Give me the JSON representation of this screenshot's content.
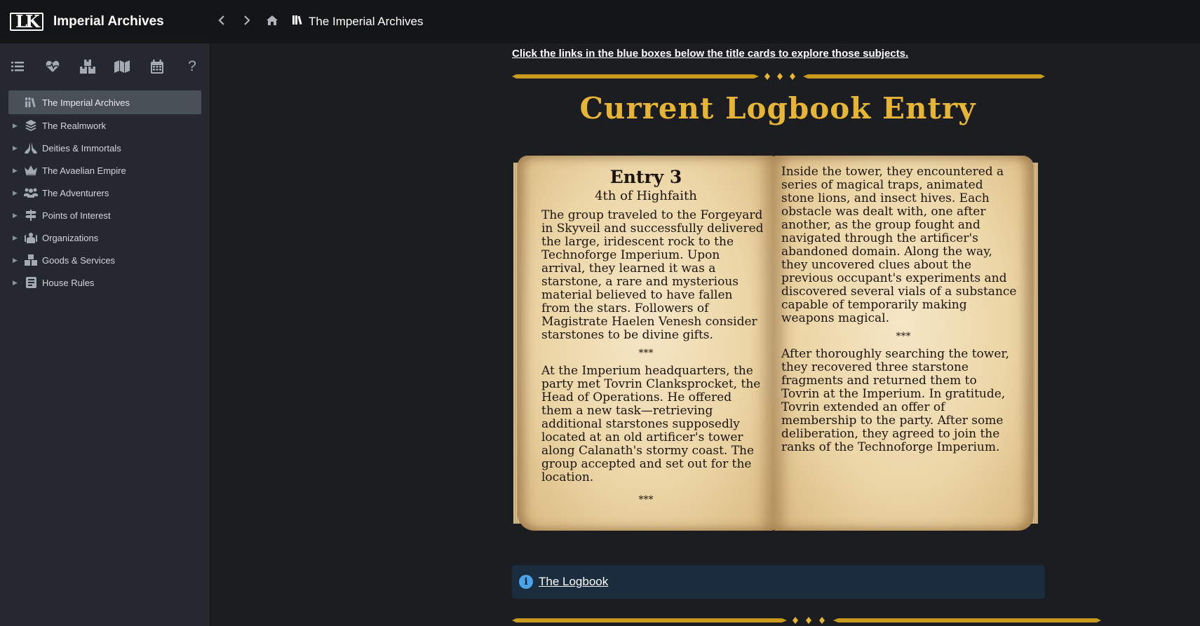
{
  "header": {
    "logo_text": "LK",
    "app_title": "Imperial Archives",
    "breadcrumb": "The Imperial Archives"
  },
  "toolbar": {
    "tools": [
      "list-icon",
      "heart-pulse-icon",
      "boxes-icon",
      "map-icon",
      "calendar-icon",
      "help-icon"
    ],
    "help_label": "?"
  },
  "sidebar": {
    "items": [
      {
        "label": "The Imperial Archives",
        "icon": "library-icon",
        "active": true
      },
      {
        "label": "The Realmwork",
        "icon": "layers-icon"
      },
      {
        "label": "Deities & Immortals",
        "icon": "praying-hands-icon"
      },
      {
        "label": "The Avaelian Empire",
        "icon": "crown-icon"
      },
      {
        "label": "The Adventurers",
        "icon": "users-icon"
      },
      {
        "label": "Points of Interest",
        "icon": "signpost-icon"
      },
      {
        "label": "Organizations",
        "icon": "group-icon"
      },
      {
        "label": "Goods & Services",
        "icon": "boxes-icon"
      },
      {
        "label": "House Rules",
        "icon": "rulebook-icon"
      }
    ]
  },
  "main": {
    "hint": "Click the links in the blue boxes below the title cards to explore those subjects.",
    "section_title": "Current Logbook Entry",
    "book": {
      "entry_title": "Entry 3",
      "entry_date": "4th of Highfaith",
      "left_p1": "The group traveled to the Forgeyard in Skyveil and successfully delivered the large, iridescent rock to the Technoforge Imperium. Upon arrival, they learned it was a starstone, a rare and mysterious material believed to have fallen from the stars. Followers of Magistrate Haelen Venesh consider starstones to be divine gifts.",
      "left_p2": "At the Imperium headquarters, the party met Tovrin Clanksprocket, the Head of Operations. He offered them a new task—retrieving additional starstones supposedly located at an old artificer's tower along Calanath's stormy coast. The group accepted and set out for the location.",
      "right_p1": "Inside the tower, they encountered a series of magical traps, animated stone lions, and insect hives. Each obstacle was dealt with, one after another, as the group fought and navigated through the artificer's abandoned domain. Along the way, they uncovered clues about the previous occupant's experiments and discovered several vials of a substance capable of temporarily making weapons magical.",
      "right_p2": "After thoroughly searching the tower, they recovered three starstone fragments and returned them to Tovrin at the Imperium. In gratitude, Tovrin extended an offer of membership to the party. After some deliberation, they agreed to join the ranks of the Technoforge Imperium.",
      "separator": "***"
    },
    "info_link": "The Logbook",
    "info_icon": "i"
  },
  "colors": {
    "accent_gold": "#e7b536",
    "info_bg": "#1a2d3f",
    "info_icon": "#4aa3e8",
    "sidebar_bg": "#25292f",
    "topbar_bg": "#141517"
  }
}
